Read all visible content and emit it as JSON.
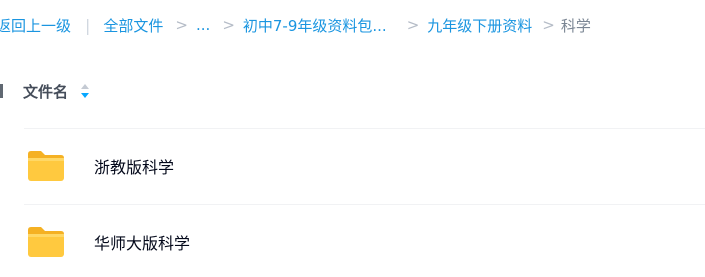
{
  "breadcrumb": {
    "back_label": "返回上一级",
    "all_files_label": "全部文件",
    "ellipsis": "...",
    "folder_1": "初中7-9年级资料包...",
    "folder_2": "九年级下册资料",
    "current": "科学",
    "separator": ">",
    "divider": "|"
  },
  "list": {
    "header_label": "文件名",
    "sort_icon": "sort-icon",
    "items": [
      {
        "name": "浙教版科学",
        "icon": "folder-icon"
      },
      {
        "name": "华师大版科学",
        "icon": "folder-icon"
      }
    ]
  },
  "colors": {
    "link": "#1a95e0",
    "folder": "#ffc53d",
    "sort_active": "#06a7ff"
  }
}
